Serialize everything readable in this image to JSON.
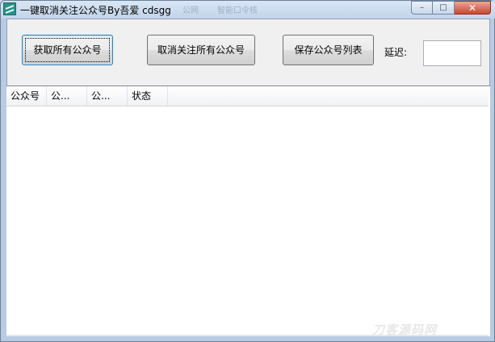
{
  "window": {
    "title": "一键取消关注公众号By吾爱 cdsgg",
    "ghost_tabs": [
      "公网",
      "智能口令核"
    ],
    "min_glyph": "–",
    "max_glyph": "□",
    "close_glyph": "✕"
  },
  "toolbar": {
    "fetch_label": "获取所有公众号",
    "unfollow_label": "取消关注所有公众号",
    "save_label": "保存公众号列表",
    "delay_label": "延迟:",
    "delay_value": ""
  },
  "list": {
    "columns": [
      "公众号",
      "公...",
      "公...",
      "状态"
    ],
    "rows": []
  },
  "watermark": "刀客源码网",
  "colors": {
    "titlebar": "#c2d4ea",
    "client_bg": "#f0f0f0",
    "close_button": "#c8482f",
    "focus_border": "#3c7fb1"
  }
}
